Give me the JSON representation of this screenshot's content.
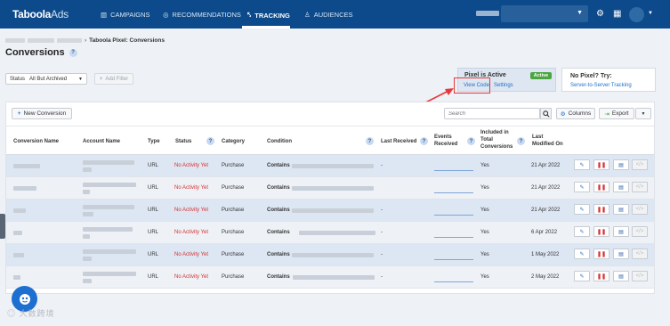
{
  "topnav": {
    "logo_main": "Taboola",
    "logo_sub": "Ads",
    "items": [
      {
        "label": "CAMPAIGNS",
        "icon": "campaigns-icon"
      },
      {
        "label": "RECOMMENDATIONS",
        "icon": "recommendations-icon"
      },
      {
        "label": "TRACKING",
        "icon": "tracking-icon",
        "active": true
      },
      {
        "label": "AUDIENCES",
        "icon": "audiences-icon"
      }
    ],
    "right_icons": [
      "gear-icon",
      "apps-grid-icon",
      "avatar",
      "chevron-down-icon"
    ]
  },
  "breadcrumb": {
    "current": "Taboola Pixel: Conversions"
  },
  "page": {
    "title": "Conversions"
  },
  "filters": {
    "status_label": "Status",
    "status_value": "All But Archived",
    "add_filter_label": "Add Filter"
  },
  "pixel_panel": {
    "title": "Pixel is Active",
    "badge": "Active",
    "view_code": "View Code",
    "settings": "Settings"
  },
  "nopixel_panel": {
    "title": "No Pixel? Try:",
    "link": "Server-to-Server Tracking"
  },
  "toolbar": {
    "new_conversion": "New Conversion",
    "search_placeholder": "Search",
    "columns": "Columns",
    "export": "Export"
  },
  "table": {
    "headers": {
      "conversion_name": "Conversion Name",
      "account_name": "Account Name",
      "type": "Type",
      "status": "Status",
      "category": "Category",
      "condition": "Condition",
      "last_received": "Last Received",
      "events_received_1": "Events",
      "events_received_2": "Received",
      "included_1": "Included in",
      "included_2": "Total",
      "included_3": "Conversions",
      "last_modified_1": "Last",
      "last_modified_2": "Modified On"
    },
    "rows": [
      {
        "type": "URL",
        "status": "No Activity Yet",
        "category": "Purchase",
        "condition": "Contains",
        "last_received": "-",
        "included": "Yes",
        "modified": "21 Apr 2022"
      },
      {
        "type": "URL",
        "status": "No Activity Yet",
        "category": "Purchase",
        "condition": "Contains",
        "last_received": "",
        "included": "Yes",
        "modified": "21 Apr 2022"
      },
      {
        "type": "URL",
        "status": "No Activity Yet",
        "category": "Purchase",
        "condition": "Contains",
        "last_received": "-",
        "included": "Yes",
        "modified": "21 Apr 2022"
      },
      {
        "type": "URL",
        "status": "No Activity Yet",
        "category": "Purchase",
        "condition": "Contains",
        "last_received": "-",
        "included": "Yes",
        "modified": "6 Apr 2022"
      },
      {
        "type": "URL",
        "status": "No Activity Yet",
        "category": "Purchase",
        "condition": "Contains",
        "last_received": "-",
        "included": "Yes",
        "modified": "1 May 2022"
      },
      {
        "type": "URL",
        "status": "No Activity Yet",
        "category": "Purchase",
        "condition": "Contains",
        "last_received": "-",
        "included": "Yes",
        "modified": "2 May 2022"
      }
    ]
  },
  "watermark": "大数跨境",
  "colors": {
    "nav": "#0c4a8b",
    "link": "#1f6fc7",
    "status_red": "#d63030",
    "active_green": "#4aa640",
    "highlight_red": "#e23a3a"
  }
}
